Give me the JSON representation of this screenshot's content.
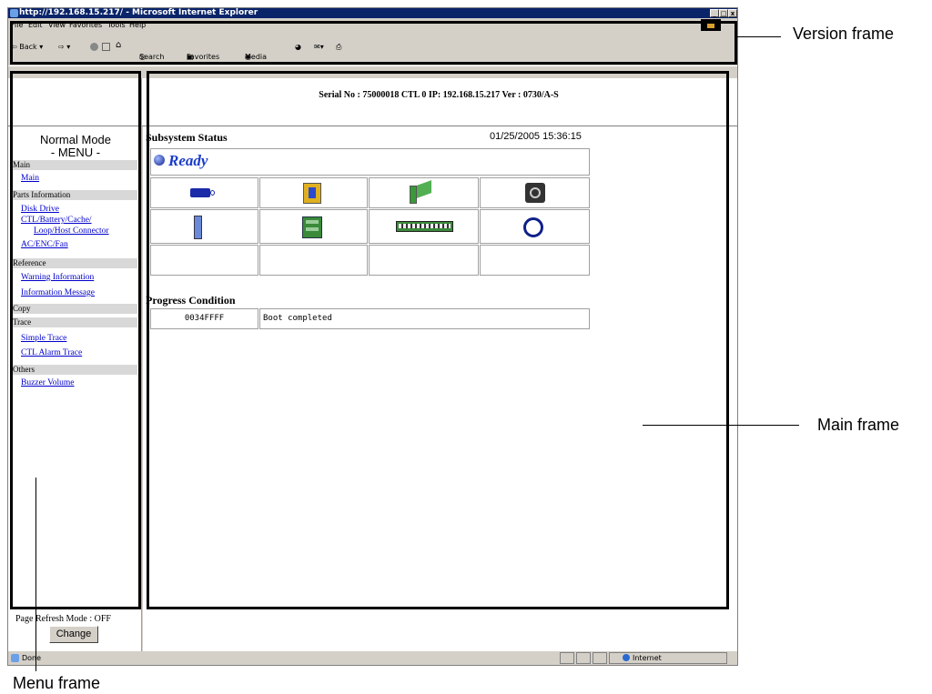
{
  "browser": {
    "title": "http://192.168.15.217/ - Microsoft Internet Explorer",
    "window_buttons": [
      "_",
      "□",
      "x"
    ],
    "menu": [
      "File",
      "Edit",
      "View",
      "Favorites",
      "Tools",
      "Help"
    ],
    "toolbar": {
      "back": "⇦ Back ▾",
      "forward": "⇨ ▾",
      "search": "Search",
      "favorites": "Favorites",
      "media": "Media"
    },
    "status": "Done",
    "zone": "Internet"
  },
  "callouts": {
    "version": "Version frame",
    "main": "Main frame",
    "menu": "Menu frame"
  },
  "version_info": "Serial No : 75000018   CTL 0   IP: 192.168.15.217   Ver : 0730/A-S",
  "menu_frame": {
    "mode": "Normal Mode",
    "menu_title": "- MENU -",
    "sections": [
      {
        "title": "Main",
        "links": [
          "Main"
        ]
      },
      {
        "title": "Parts Information",
        "links": [
          "Disk Drive",
          "CTL/Battery/Cache/",
          "Loop/Host Connector",
          "AC/ENC/Fan"
        ]
      },
      {
        "title": "Reference",
        "links": [
          "Warning Information",
          "Information Message"
        ]
      },
      {
        "title": "Copy",
        "links": []
      },
      {
        "title": "Trace",
        "links": [
          "Simple Trace",
          "CTL Alarm Trace"
        ]
      },
      {
        "title": "Others",
        "links": [
          "Buzzer Volume"
        ]
      }
    ],
    "refresh_label": "Page Refresh Mode : OFF",
    "change_button": "Change"
  },
  "main_frame": {
    "subsystem_title": "Subsystem Status",
    "timestamp": "01/25/2005 15:36:15",
    "status": "Ready",
    "icons_row1": [
      "battery-icon",
      "power-supply-icon",
      "controller-board-icon",
      "fan-icon"
    ],
    "icons_row2": [
      "disk-drive-icon",
      "cache-board-icon",
      "host-connector-icon",
      "loop-icon"
    ],
    "progress_title": "Progress Condition",
    "progress_code": "0034FFFF",
    "progress_text": "Boot completed"
  },
  "colors": {
    "titlebar": "#0a246a",
    "link": "#0000cc",
    "ready": "#1a3cc8"
  }
}
